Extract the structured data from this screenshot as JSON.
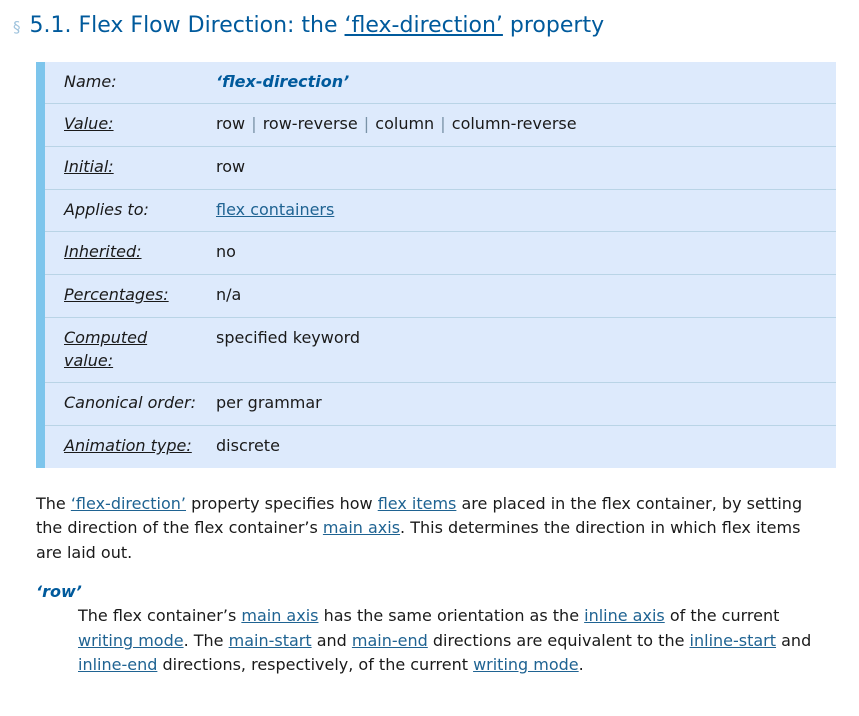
{
  "heading": {
    "marker": "§",
    "number": "5.1.",
    "title_before": "Flex Flow Direction: the",
    "property_link": "‘flex-direction’",
    "title_after": "property"
  },
  "propdef": {
    "rows": [
      {
        "label": "Name:",
        "label_is_link": false,
        "value_kind": "propname",
        "value": "‘flex-direction’"
      },
      {
        "label": "Value:",
        "label_is_link": true,
        "value_kind": "grammar",
        "value": "row | row-reverse | column | column-reverse",
        "grammar_terms": [
          "row",
          "row-reverse",
          "column",
          "column-reverse"
        ],
        "grammar_separator": "|"
      },
      {
        "label": "Initial:",
        "label_is_link": true,
        "value_kind": "text",
        "value": "row"
      },
      {
        "label": "Applies to:",
        "label_is_link": false,
        "value_kind": "link",
        "value": "flex containers"
      },
      {
        "label": "Inherited:",
        "label_is_link": true,
        "value_kind": "text",
        "value": "no"
      },
      {
        "label": "Percentages:",
        "label_is_link": true,
        "value_kind": "text",
        "value": "n/a"
      },
      {
        "label": "Computed value:",
        "label_is_link": true,
        "value_kind": "text",
        "value": "specified keyword"
      },
      {
        "label": "Canonical order:",
        "label_is_link": false,
        "value_kind": "text",
        "value": "per grammar"
      },
      {
        "label": "Animation type:",
        "label_is_link": true,
        "value_kind": "text",
        "value": "discrete"
      }
    ]
  },
  "prose": {
    "p1": {
      "s1": "The ",
      "link1": "‘flex-direction’",
      "s2": " property specifies how ",
      "link2": "flex items",
      "s3": " are placed in the flex container, by setting the direction of the flex container’s ",
      "link3": "main axis",
      "s4": ". This determines the direction in which flex items are laid out."
    }
  },
  "value_defs": [
    {
      "term": "‘row’",
      "desc": {
        "s1": "The flex container’s ",
        "link1": "main axis",
        "s2": " has the same orientation as the ",
        "link2": "inline axis",
        "s3": " of the current ",
        "link3": "writing mode",
        "s4": ". The ",
        "link4": "main-start",
        "s5": " and ",
        "link5": "main-end",
        "s6": " directions are equivalent to the ",
        "link6": "inline-start",
        "s7": " and ",
        "link7": "inline-end",
        "s8": " directions, respectively, of the current ",
        "link8": "writing mode",
        "s9": "."
      }
    }
  ],
  "colors": {
    "heading": "#005a9c",
    "link": "#1f6392",
    "propdef_background": "#ddeafc",
    "propdef_accent": "#7dc5ec",
    "propdef_divider": "#b9d4e6",
    "section_marker": "#9fc3dd",
    "text": "#1a1a1a",
    "grammar_bar": "#7a93a8"
  }
}
